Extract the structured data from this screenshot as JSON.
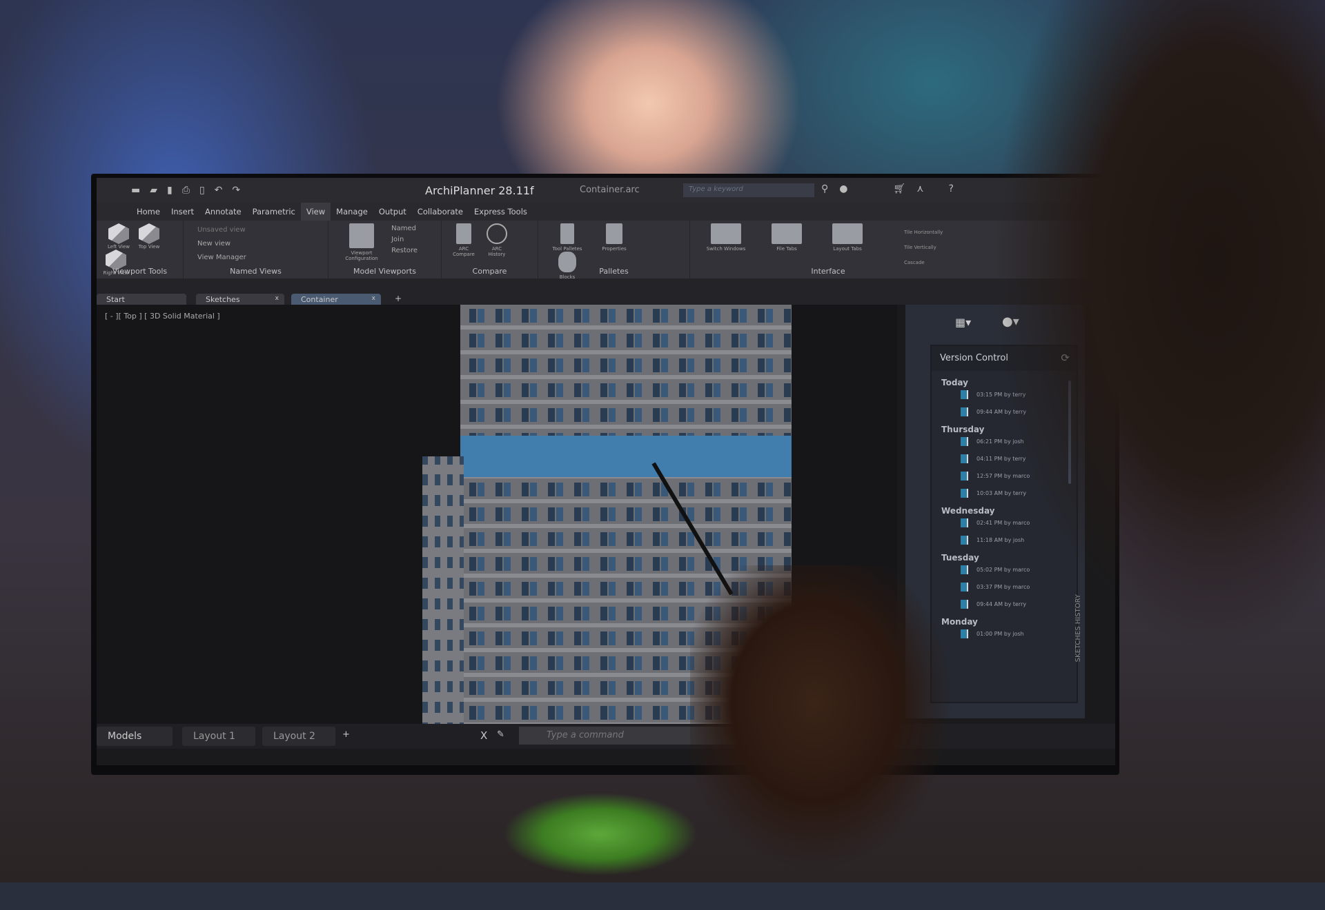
{
  "window": {
    "app_title": "ArchiPlanner 28.11f",
    "file_name": "Container.arc",
    "search_placeholder": "Type a keyword"
  },
  "menu": [
    "Home",
    "Insert",
    "Annotate",
    "Parametric",
    "View",
    "Manage",
    "Output",
    "Collaborate",
    "Express Tools"
  ],
  "active_menu": "View",
  "ribbon": {
    "viewport_tools": {
      "label": "Viewport Tools",
      "items": [
        "Left View",
        "Top View",
        "Right View"
      ]
    },
    "named_views": {
      "label": "Named Views",
      "items": [
        "Unsaved view",
        "New view",
        "View Manager"
      ]
    },
    "model_viewports": {
      "label": "Model Viewports",
      "tool": "Viewport Configuration",
      "items": [
        "Named",
        "Join",
        "Restore"
      ]
    },
    "compare": {
      "label": "Compare",
      "items": [
        "ARC Compare",
        "ARC History"
      ]
    },
    "palletes": {
      "label": "Palletes",
      "items": [
        "Tool Palletes",
        "Properties",
        "Blocks"
      ]
    },
    "interface": {
      "label": "Interface",
      "items": [
        "Switch Windows",
        "File Tabs",
        "Layout Tabs"
      ],
      "tile": [
        "Tile Horizontally",
        "Tile Vertically",
        "Cascade"
      ]
    }
  },
  "doc_tabs": [
    {
      "label": "Start"
    },
    {
      "label": "Sketches",
      "close": "x"
    },
    {
      "label": "Container",
      "close": "x",
      "active": true
    }
  ],
  "add_tab": "+",
  "viewport_label": "[ - ][ Top ] [ 3D Solid Material ]",
  "version_control": {
    "title": "Version Control",
    "groups": [
      {
        "day": "Today",
        "versions": [
          "03:15 PM by terry",
          "09:44 AM by terry"
        ]
      },
      {
        "day": "Thursday",
        "versions": [
          "06:21 PM by josh",
          "04:11 PM by terry",
          "12:57 PM by marco",
          "10:03 AM by terry"
        ]
      },
      {
        "day": "Wednesday",
        "versions": [
          "02:41 PM by marco",
          "11:18 AM by josh"
        ]
      },
      {
        "day": "Tuesday",
        "versions": [
          "05:02 PM by marco",
          "03:37 PM by marco",
          "09:44 AM by terry"
        ]
      },
      {
        "day": "Monday",
        "versions": [
          "01:00 PM by josh"
        ]
      }
    ],
    "side_tab": "SKETCHES HISTORY"
  },
  "layout_tabs": [
    "Models",
    "Layout 1",
    "Layout 2"
  ],
  "add_layout": "+",
  "command": {
    "placeholder": "Type a command",
    "close": "X"
  },
  "colors": {
    "accent": "#2e7fa6",
    "ui_bg": "#2c2c30"
  }
}
